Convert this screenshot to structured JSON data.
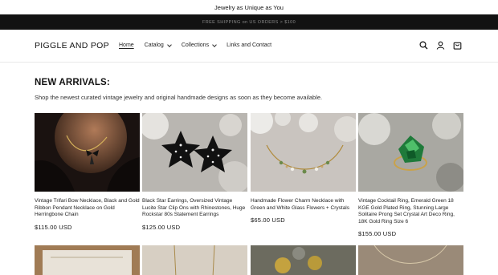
{
  "announcement": {
    "main": "Jewelry as Unique as You",
    "shipping": "FREE SHIPPING on US ORDERS > $100"
  },
  "header": {
    "logo": "PIGGLE AND POP",
    "nav": [
      {
        "label": "Home"
      },
      {
        "label": "Catalog"
      },
      {
        "label": "Collections"
      },
      {
        "label": "Links and Contact"
      }
    ],
    "icons": [
      "search-icon",
      "account-icon",
      "cart-icon"
    ]
  },
  "section": {
    "title": "NEW ARRIVALS:",
    "subtitle": "Shop the newest curated vintage jewelry and original handmade designs as soon as they become available."
  },
  "products": [
    {
      "title": "Vintage Trifari Bow Necklace, Black and Gold Ribbon Pendant Necklace on Gold Herringbone Chain",
      "price": "$115.00 USD"
    },
    {
      "title": "Black Star Earrings, Oversized Vintage Lucite Star Clip Ons with Rhinestones, Huge Rockstar 80s Statement Earrings",
      "price": "$125.00 USD"
    },
    {
      "title": "Handmade Flower Charm Necklace with Green and White Glass Flowers + Crystals",
      "price": "$65.00 USD"
    },
    {
      "title": "Vintage Cocktail Ring, Emerald Green 18 KGE Gold Plated Ring, Stunning Large Solitaire Prong Set Crystal Art Deco Ring, 18K Gold Ring Size 6",
      "price": "$155.00 USD"
    }
  ]
}
